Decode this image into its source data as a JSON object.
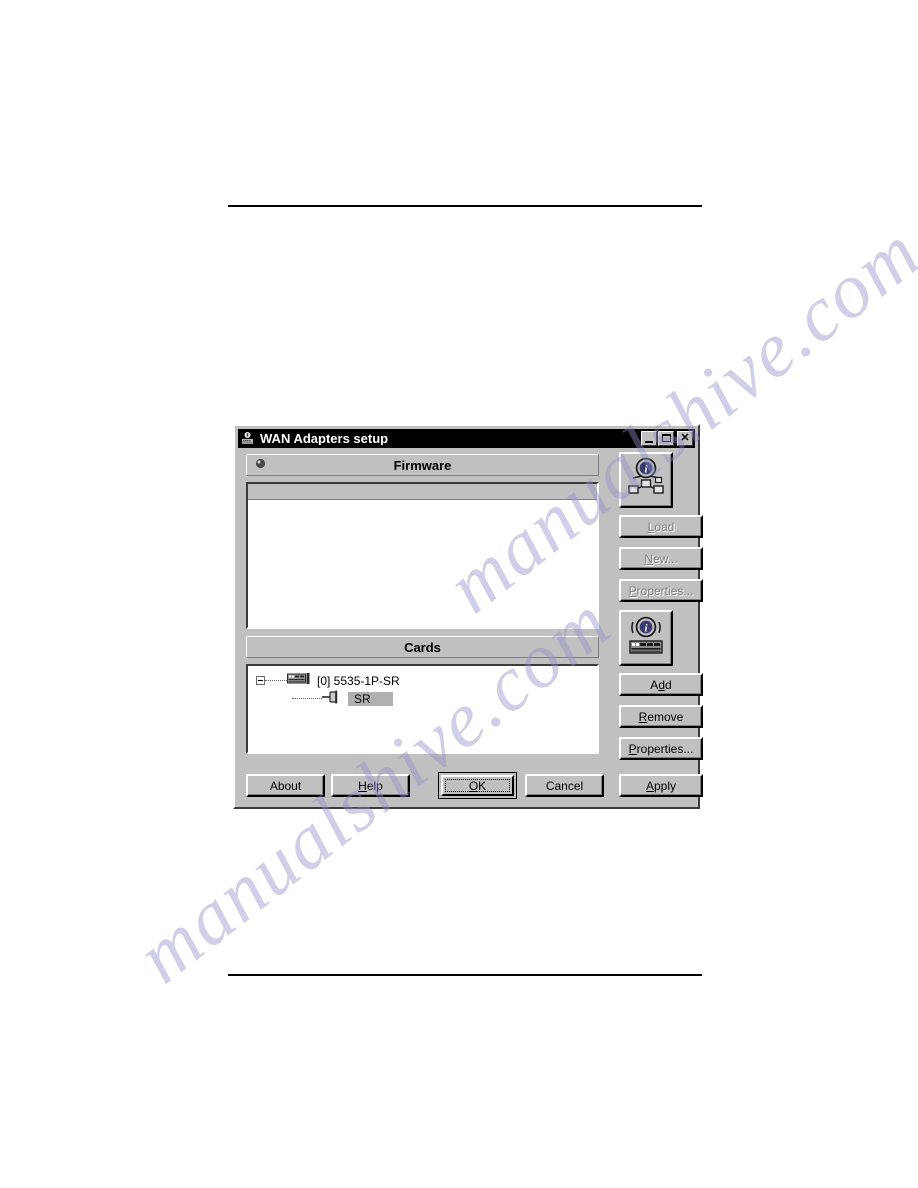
{
  "window": {
    "title": "WAN Adapters setup",
    "title_icon": "wan-adapter-icon",
    "controls": {
      "minimize": "minimize-icon",
      "maximize": "maximize-icon",
      "close": "close-icon",
      "close_glyph": "✕"
    }
  },
  "firmware": {
    "label": "Firmware",
    "icon": "firmware-bullet-icon",
    "items": []
  },
  "cards": {
    "label": "Cards",
    "tree": [
      {
        "label": "[0] 5535-1P-SR",
        "icon": "card-board-icon",
        "expanded": true,
        "selected": false,
        "children": [
          {
            "label": "SR",
            "icon": "port-connector-icon",
            "selected": true
          }
        ]
      }
    ]
  },
  "side_buttons": {
    "firmware_icon_button": "firmware-network-icon",
    "cards_icon_button": "card-info-icon",
    "load": {
      "label": "Load",
      "accel": "L",
      "enabled": false
    },
    "new": {
      "label": "New...",
      "accel": "N",
      "enabled": false
    },
    "firmware_properties": {
      "label": "Properties...",
      "accel": "P",
      "enabled": false
    },
    "add": {
      "label": "Add",
      "accel": "d",
      "enabled": true
    },
    "remove": {
      "label": "Remove",
      "accel": "R",
      "enabled": true
    },
    "card_properties": {
      "label": "Properties...",
      "accel": "P",
      "enabled": true
    },
    "apply": {
      "label": "Apply",
      "accel": "A",
      "enabled": true
    }
  },
  "bottom_buttons": {
    "about": {
      "label": "About",
      "accel": "",
      "default": false
    },
    "help": {
      "label": "Help",
      "accel": "H",
      "default": false
    },
    "ok": {
      "label": "OK",
      "accel": "O",
      "default": true
    },
    "cancel": {
      "label": "Cancel",
      "accel": "",
      "default": false
    }
  },
  "watermark": {
    "line1": "manualshive.com",
    "line2": "manualshive.com"
  },
  "colors": {
    "window_face": "#c0c0c0",
    "titlebar": "#000000",
    "titlebar_text": "#ffffff",
    "list_background": "#ffffff",
    "selection": "#b0b0b0",
    "disabled_text": "#808080",
    "page_rule": "#000000"
  }
}
